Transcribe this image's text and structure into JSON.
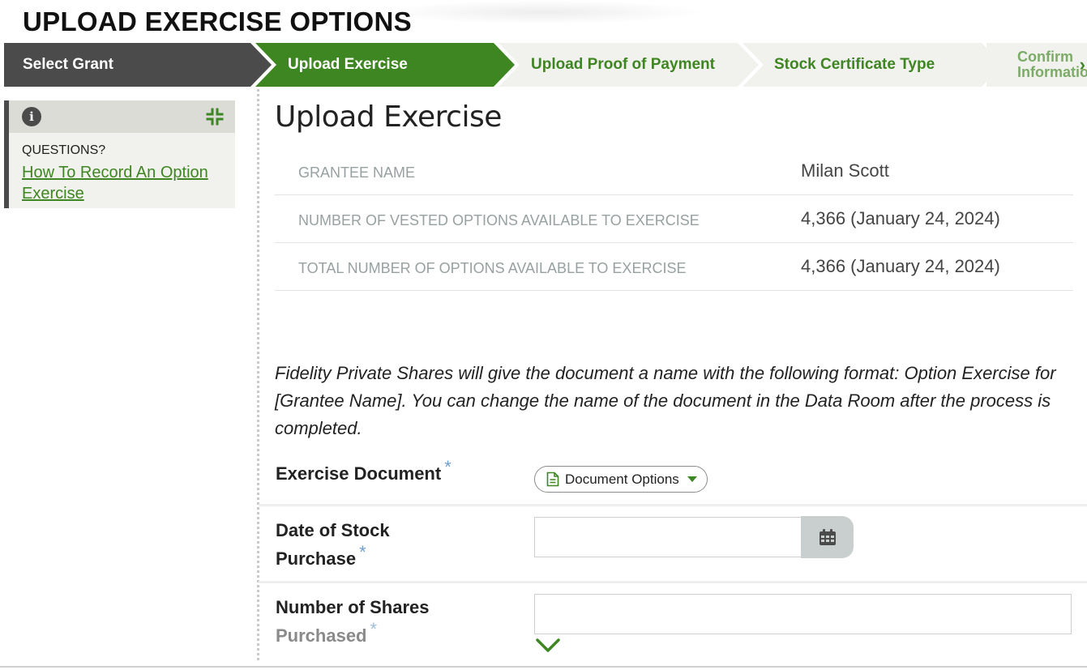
{
  "page": {
    "title": "UPLOAD EXERCISE OPTIONS"
  },
  "stepper": {
    "steps": [
      {
        "label": "Select Grant",
        "state": "done"
      },
      {
        "label": "Upload Exercise",
        "state": "active"
      },
      {
        "label": "Upload Proof of Payment",
        "state": "pending"
      },
      {
        "label": "Stock Certificate Type",
        "state": "pending"
      },
      {
        "label": "Confirm Information",
        "state": "pending"
      }
    ],
    "next_icon": "chevron-right-icon"
  },
  "help": {
    "info_icon": "info-icon",
    "info_glyph": "i",
    "collapse_icon": "collapse-icon",
    "question": "QUESTIONS?",
    "link": "How To Record An Option Exercise"
  },
  "main": {
    "title": "Upload Exercise",
    "info_rows": [
      {
        "key": "GRANTEE NAME",
        "value": "Milan Scott"
      },
      {
        "key": "NUMBER OF VESTED OPTIONS AVAILABLE TO EXERCISE",
        "value": "4,366 (January 24, 2024)"
      },
      {
        "key": "TOTAL NUMBER OF OPTIONS AVAILABLE TO EXERCISE",
        "value": "4,366 (January 24, 2024)"
      }
    ],
    "note": "Fidelity Private Shares will give the document a name with the following format: Option Exercise for [Grantee Name]. You can change the name of the document in the Data Room after the process is completed."
  },
  "form": {
    "required_mark": "*",
    "exercise_document": {
      "label": "Exercise Document",
      "button": "Document Options",
      "icon": "document-icon"
    },
    "date_of_purchase": {
      "label_line1": "Date of Stock",
      "label_line2": "Purchase",
      "value": "",
      "icon": "calendar-icon"
    },
    "number_of_shares": {
      "label_line1": "Number of Shares",
      "label_line2": "Purchased",
      "value": "",
      "icon": "chevron-down-icon"
    }
  },
  "colors": {
    "brand_green": "#3e8621",
    "dark_step": "#4b4b4b",
    "muted_key": "#97a1a1",
    "required": "#6f9fd0"
  }
}
